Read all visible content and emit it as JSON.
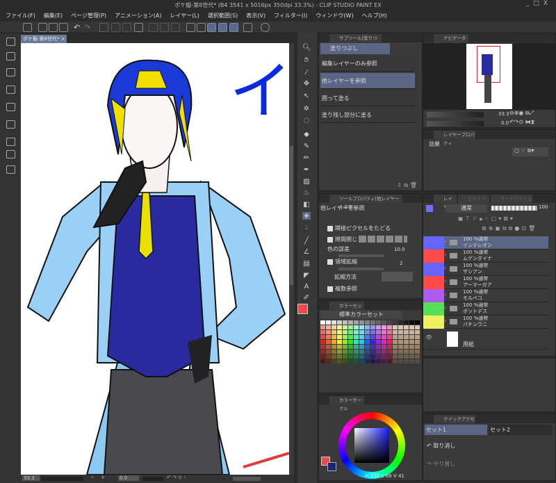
{
  "window": {
    "title": "ポケ擬-第8世代* (B4 3541 x 5016px 350dpi 33.3%) - CLIP STUDIO PAINT EX",
    "controls": [
      "_",
      "□",
      "X"
    ]
  },
  "menu": [
    "ファイル(F)",
    "編集(E)",
    "ページ管理(P)",
    "アニメーション(A)",
    "レイヤー(L)",
    "選択範囲(S)",
    "表示(V)",
    "フィルター(I)",
    "ウィンドウ(W)",
    "ヘルプ(H)"
  ],
  "document_tab": {
    "label": "ポケ擬-第8世代*",
    "close": "×"
  },
  "canvas_text": "イ",
  "status": {
    "zoom": "33.3",
    "rotation": "0.0",
    "zoom_out": "−",
    "zoom_in": "+"
  },
  "subtool": {
    "tab": "サブツール[塗りつぶし]",
    "group": "塗りつぶし",
    "items": [
      "編集レイヤーのみ参照",
      "他レイヤーを参照",
      "囲って塗る",
      "塗り残し部分に塗る"
    ],
    "selected": 1
  },
  "tool_property": {
    "tab": "ツールプロパティ[他レイヤーを参照]",
    "title": "他レイヤーを参照",
    "follow_adjacent": "隣接ピクセルをたどる",
    "close_gap": "隙間閉じ",
    "color_margin": "色の誤差",
    "color_margin_value": "10.0",
    "area_scaling": "領域拡縮",
    "area_scaling_value": "2",
    "scaling_method": "拡縮方法",
    "multi_ref": "複数参照"
  },
  "colorset": {
    "tab": "カラーセット",
    "selected": "標準カラーセット"
  },
  "colorcircle": {
    "tab": "カラーサークル",
    "h": "232",
    "s": "68",
    "v": "41",
    "main_color": "#f04848",
    "sub_color": "#1e2670"
  },
  "navigator": {
    "tab": "ナビゲーター",
    "zoom": "33.3",
    "rotation": "0.0"
  },
  "layer_property": {
    "tab": "レイヤープロパティ",
    "effect": "効果"
  },
  "layers": {
    "tabs": [
      "レイヤー",
      "ヒストリー",
      "オートアクション"
    ],
    "blend": "通常",
    "opacity": "100",
    "items": [
      {
        "mode": "100 %通常",
        "name": "インテレオン",
        "color": "#6666ff",
        "selected": true
      },
      {
        "mode": "100 %通常",
        "name": "ムゲンダイナ",
        "color": "#ff4a4a"
      },
      {
        "mode": "100 %通常",
        "name": "ザシアン",
        "color": "#6666ff"
      },
      {
        "mode": "100 %通常",
        "name": "アーマーガア",
        "color": "#ff4a4a"
      },
      {
        "mode": "100 %通常",
        "name": "モルペコ",
        "color": "#b05af0"
      },
      {
        "mode": "100 %通常",
        "name": "ポットデス",
        "color": "#55e055"
      },
      {
        "mode": "100 %通常",
        "name": "バチンウニ",
        "color": "#f0f060"
      }
    ],
    "paper": "用紙"
  },
  "quick_access": {
    "tab": "クイックアクセス",
    "sets": [
      "セット1",
      "セット2"
    ],
    "items": [
      "取り消し",
      "やり直し"
    ]
  }
}
